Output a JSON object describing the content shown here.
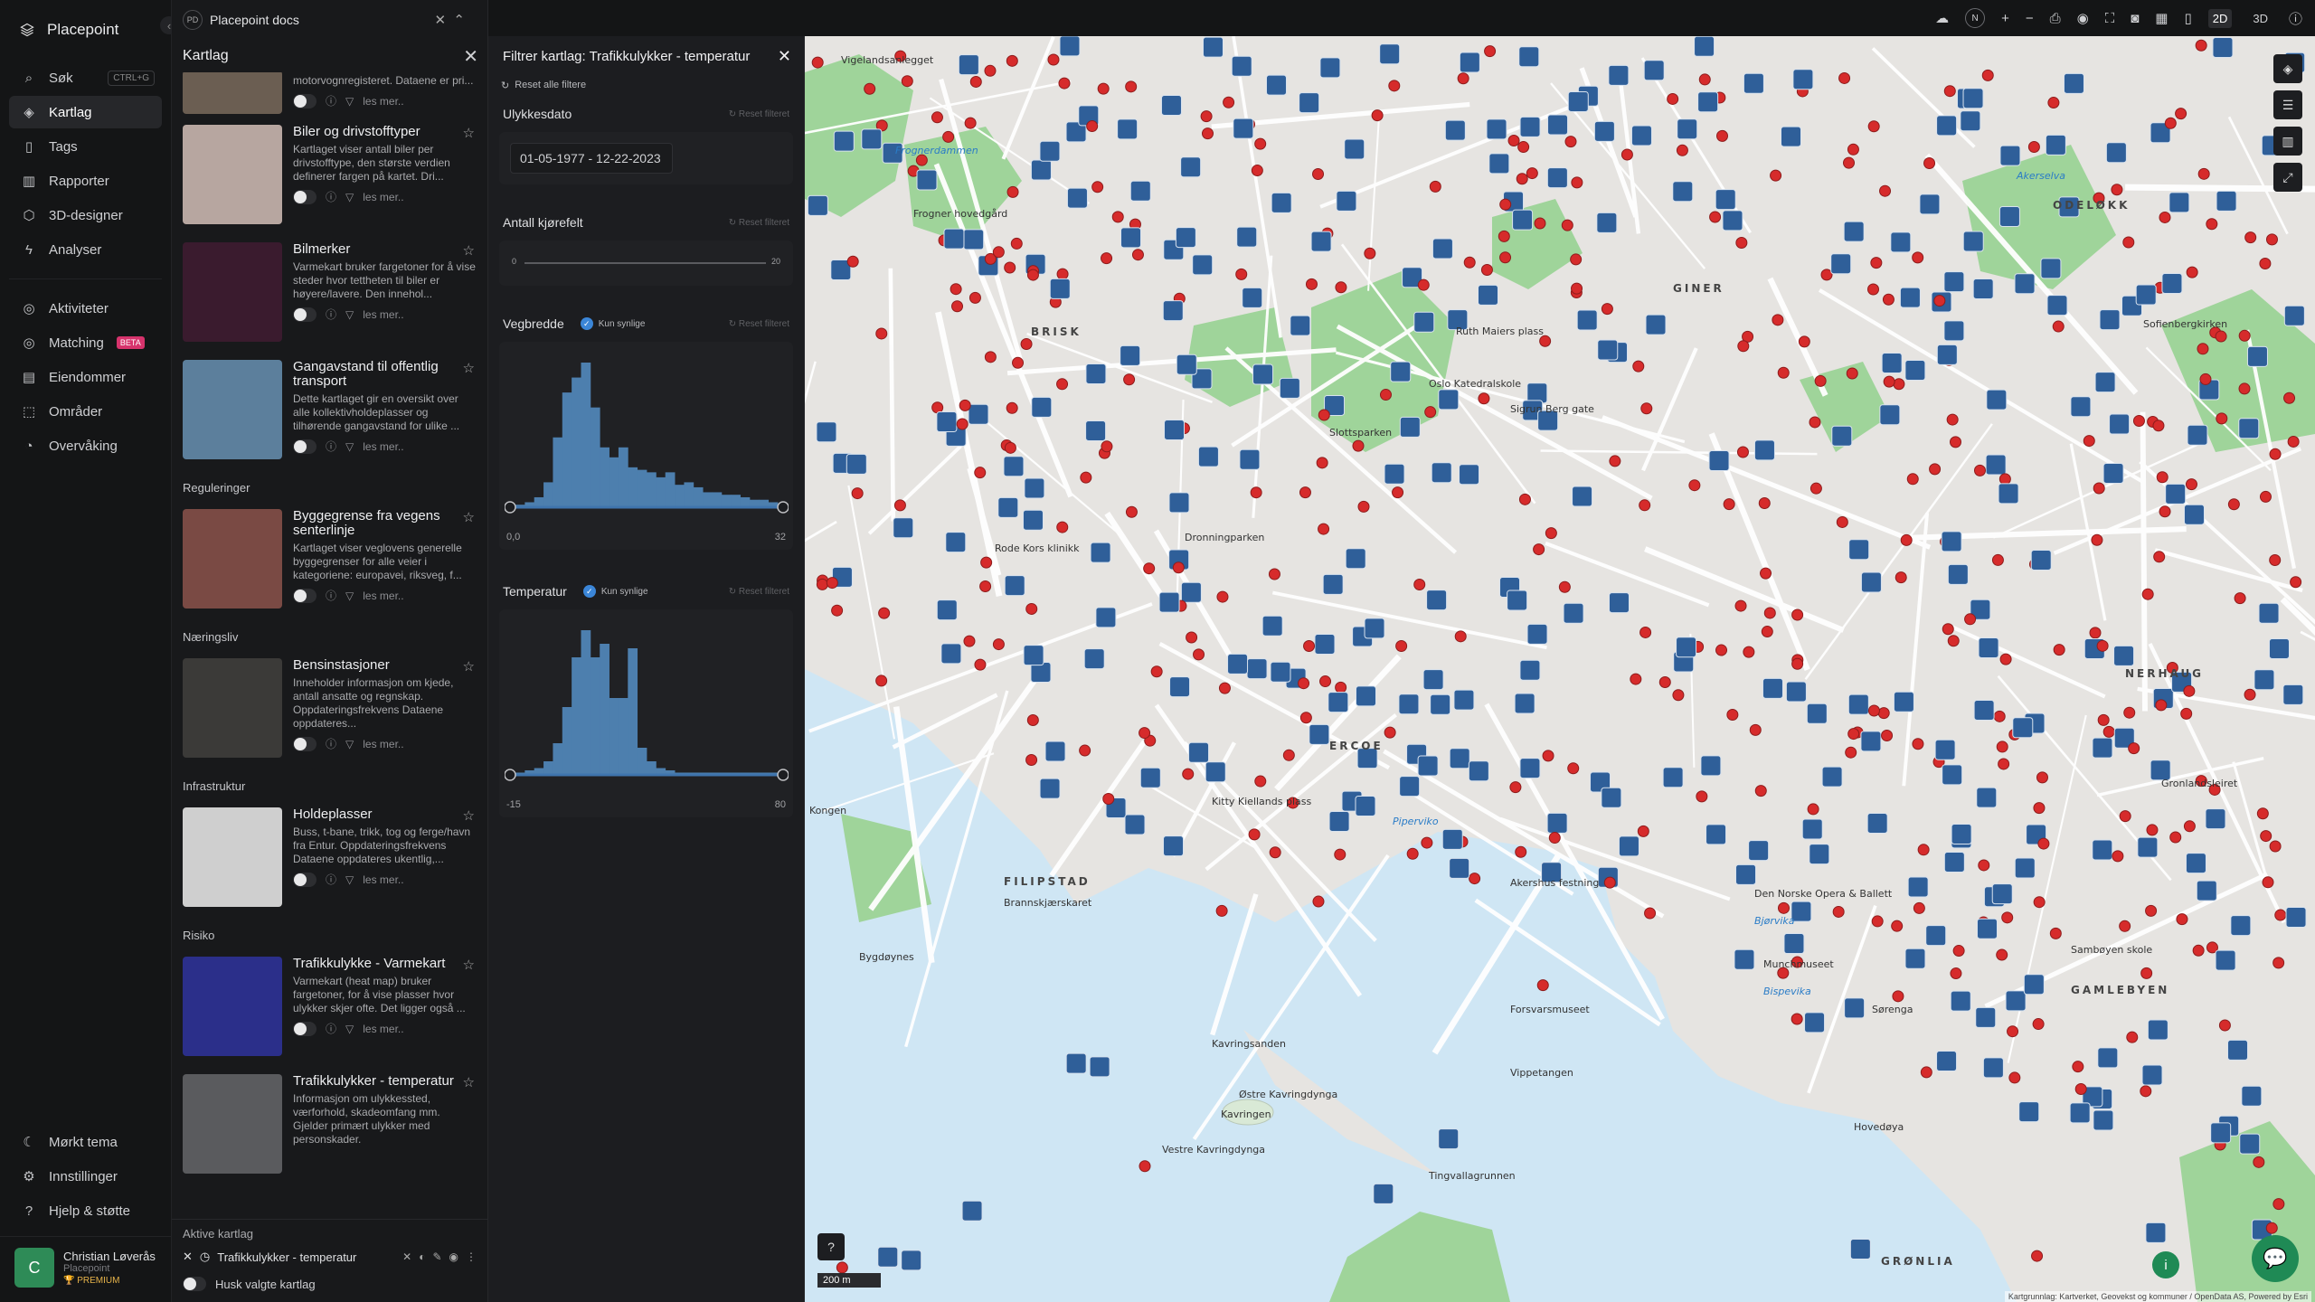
{
  "app": {
    "name": "Placepoint"
  },
  "nav": {
    "items": [
      {
        "label": "Søk",
        "icon": "search-icon",
        "shortcut": "CTRL+G"
      },
      {
        "label": "Kartlag",
        "icon": "layers-icon",
        "active": true
      },
      {
        "label": "Tags",
        "icon": "bookmark-icon"
      },
      {
        "label": "Rapporter",
        "icon": "bar-chart-icon"
      },
      {
        "label": "3D-designer",
        "icon": "cube-icon"
      },
      {
        "label": "Analyser",
        "icon": "bolt-icon"
      }
    ],
    "items2": [
      {
        "label": "Aktiviteter",
        "icon": "activity-icon"
      },
      {
        "label": "Matching",
        "icon": "target-icon",
        "badge": "BETA"
      },
      {
        "label": "Eiendommer",
        "icon": "building-icon"
      },
      {
        "label": "Områder",
        "icon": "area-icon"
      },
      {
        "label": "Overvåking",
        "icon": "monitor-icon"
      }
    ],
    "bottom": [
      {
        "label": "Mørkt tema",
        "icon": "moon-icon"
      },
      {
        "label": "Innstillinger",
        "icon": "gear-icon"
      },
      {
        "label": "Hjelp & støtte",
        "icon": "help-icon"
      }
    ],
    "user": {
      "initial": "C",
      "name": "Christian Løverås",
      "company": "Placepoint",
      "plan": "PREMIUM"
    }
  },
  "doc": {
    "badge": "PD",
    "title": "Placepoint docs"
  },
  "layers": {
    "title": "Kartlag",
    "top_partial": {
      "desc": "motorvognregisteret. Dataene er pri...",
      "more": "les mer.."
    },
    "cards": [
      {
        "title": "Biler og drivstofftyper",
        "desc": "Kartlaget viser antall biler per drivstofftype, den største verdien definerer fargen på kartet. Dri...",
        "more": "les mer..",
        "thumb": "#b7a6a0"
      },
      {
        "title": "Bilmerker",
        "desc": "Varmekart bruker fargetoner for å vise steder hvor tettheten til biler er høyere/lavere. Den innehol...",
        "more": "les mer..",
        "thumb": "#3a1b2e"
      },
      {
        "title": "Gangavstand til offentlig transport",
        "desc": "Dette kartlaget gir en oversikt over alle kollektivholdeplasser og tilhørende gangavstand for ulike ...",
        "more": "les mer..",
        "thumb": "#5c7f9c"
      }
    ],
    "sections": [
      {
        "label": "Reguleringer",
        "cards": [
          {
            "title": "Byggegrense fra vegens senterlinje",
            "desc": "Kartlaget viser veglovens generelle byggegrenser for alle veier i kategoriene: europavei, riksveg, f...",
            "more": "les mer..",
            "thumb": "#7a4a44"
          }
        ]
      },
      {
        "label": "Næringsliv",
        "cards": [
          {
            "title": "Bensinstasjoner",
            "desc": "Inneholder informasjon om kjede, antall ansatte og regnskap. Oppdateringsfrekvens Dataene oppdateres...",
            "more": "les mer..",
            "thumb": "#3b3a38"
          }
        ]
      },
      {
        "label": "Infrastruktur",
        "cards": [
          {
            "title": "Holdeplasser",
            "desc": "Buss, t-bane, trikk, tog og ferge/havn fra Entur. Oppdateringsfrekvens Dataene oppdateres ukentlig,...",
            "more": "les mer..",
            "thumb": "#cfcfcf"
          }
        ]
      },
      {
        "label": "Risiko",
        "cards": [
          {
            "title": "Trafikkulykke - Varmekart",
            "desc": "Varmekart (heat map) bruker fargetoner, for å vise plasser hvor ulykker skjer ofte. Det ligger også ...",
            "more": "les mer..",
            "thumb": "#2b2f8a"
          },
          {
            "title": "Trafikkulykker - temperatur",
            "desc": "Informasjon om ulykkessted, værforhold, skadeomfang mm. Gjelder primært ulykker med personskader.",
            "more": "",
            "thumb": "#5a5b5e"
          }
        ]
      }
    ],
    "active": {
      "label": "Aktive kartlag",
      "item": "Trafikkulykker - temperatur",
      "remember": "Husk valgte kartlag"
    }
  },
  "filter": {
    "title": "Filtrer kartlag: Trafikkulykker - temperatur",
    "reset_all": "Reset alle filtere",
    "reset_label": "Reset filteret",
    "visible_label": "Kun synlige",
    "date": {
      "label": "Ulykkesdato",
      "value": "01-05-1977 - 12-22-2023"
    },
    "lanes": {
      "label": "Antall kjørefelt",
      "min": "0",
      "max": "20"
    },
    "width": {
      "label": "Vegbredde",
      "min": "0,0",
      "max": "32",
      "bins": [
        1,
        2,
        4,
        10,
        28,
        46,
        52,
        58,
        40,
        24,
        20,
        24,
        16,
        15,
        14,
        12,
        14,
        9,
        10,
        8,
        6,
        6,
        5,
        5,
        4,
        3,
        3,
        2
      ]
    },
    "temp": {
      "label": "Temperatur",
      "min": "-15",
      "max": "80",
      "bins": [
        1,
        2,
        3,
        6,
        14,
        30,
        52,
        64,
        52,
        58,
        34,
        34,
        56,
        12,
        6,
        3,
        2,
        1,
        1,
        1,
        1,
        1,
        1,
        1,
        1,
        1,
        1,
        1
      ]
    }
  },
  "map": {
    "labels": [
      {
        "text": "Vigelandsanlegget"
      },
      {
        "text": "Frognerdammen",
        "kind": "water"
      },
      {
        "text": "Frogner hovedgård"
      },
      {
        "text": "BRISK",
        "kind": "district"
      },
      {
        "text": "Slottsparken"
      },
      {
        "text": "Oslo Katedralskole"
      },
      {
        "text": "Sigrun Berg gate"
      },
      {
        "text": "Ruth Maiers plass"
      },
      {
        "text": "GINER",
        "kind": "district"
      },
      {
        "text": "ODELØKK",
        "kind": "district"
      },
      {
        "text": "Akerselva",
        "kind": "water"
      },
      {
        "text": "Rode Kors klinikk"
      },
      {
        "text": "Dronningparken"
      },
      {
        "text": "ERCOE",
        "kind": "district"
      },
      {
        "text": "Kitty Kiellands plass"
      },
      {
        "text": "Piperviko",
        "kind": "water"
      },
      {
        "text": "FILIPSTAD",
        "kind": "district"
      },
      {
        "text": "Brannskjærskaret"
      },
      {
        "text": "Kongen"
      },
      {
        "text": "Bygdøynes"
      },
      {
        "text": "Kavringsanden"
      },
      {
        "text": "Kavringen"
      },
      {
        "text": "Østre Kavringdynga"
      },
      {
        "text": "Vestre Kavringdynga"
      },
      {
        "text": "Tingvallagrunnen"
      },
      {
        "text": "Akershus festning"
      },
      {
        "text": "Den Norske Opera & Ballett"
      },
      {
        "text": "Bjørvika",
        "kind": "water"
      },
      {
        "text": "Munchmuseet"
      },
      {
        "text": "Bispevika",
        "kind": "water"
      },
      {
        "text": "Sørenga"
      },
      {
        "text": "GAMLEBYEN",
        "kind": "district"
      },
      {
        "text": "GRØNLIA",
        "kind": "district"
      },
      {
        "text": "Vippetangen"
      },
      {
        "text": "Forsvarsmuseet"
      },
      {
        "text": "NERHAUG",
        "kind": "district"
      },
      {
        "text": "Sofienbergkirken"
      },
      {
        "text": "Gronlandsleiret"
      },
      {
        "text": "Hovedøya"
      },
      {
        "text": "Sambøyen skole"
      }
    ],
    "scale": "200 m",
    "attribution": "Kartgrunnlag: Kartverket, Geovekst og kommuner / OpenData AS, Powered by Esri",
    "water_color": "#cfe6f4",
    "park_color": "#9fd49a",
    "marker_red": "#d62b2b",
    "marker_blue": "#2f5f99"
  },
  "topbar": {
    "mode2d": "2D",
    "mode3d": "3D",
    "compass": "N"
  }
}
